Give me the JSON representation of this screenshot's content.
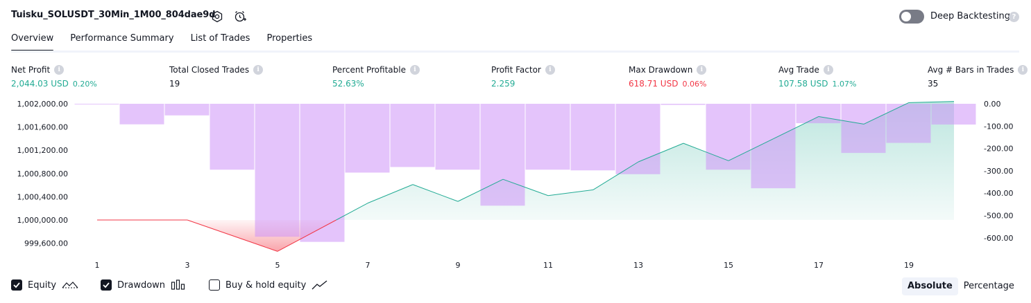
{
  "header": {
    "strategy_title": "Tuisku_SOLUSDT_30Min_1M00_804dae9d",
    "icons": [
      "settings-icon",
      "add-alert-icon"
    ],
    "deep_backtesting_label": "Deep Backtesting",
    "deep_backtesting_on": false
  },
  "tabs": [
    {
      "label": "Overview",
      "active": true
    },
    {
      "label": "Performance Summary",
      "active": false
    },
    {
      "label": "List of Trades",
      "active": false
    },
    {
      "label": "Properties",
      "active": false
    }
  ],
  "metrics": {
    "net_profit": {
      "label": "Net Profit",
      "value": "2,044.03 USD",
      "pct": "0.20%"
    },
    "total_closed_trades": {
      "label": "Total Closed Trades",
      "value": "19"
    },
    "percent_profitable": {
      "label": "Percent Profitable",
      "value": "52.63%"
    },
    "profit_factor": {
      "label": "Profit Factor",
      "value": "2.259"
    },
    "max_drawdown": {
      "label": "Max Drawdown",
      "value": "618.71 USD",
      "pct": "0.06%"
    },
    "avg_trade": {
      "label": "Avg Trade",
      "value": "107.58 USD",
      "pct": "1.07%"
    },
    "avg_bars": {
      "label": "Avg # Bars in Trades",
      "value": "35"
    }
  },
  "colors": {
    "positive": "#22ab94",
    "negative": "#f23645",
    "drawdown_bar": "#ce93f8",
    "equity_line": "#22ab94"
  },
  "chart_data": {
    "type": "line",
    "x_ticks": [
      "1",
      "3",
      "5",
      "7",
      "9",
      "11",
      "13",
      "15",
      "17",
      "19"
    ],
    "y_left_ticks": [
      "1,002,000.00",
      "1,001,600.00",
      "1,001,200.00",
      "1,000,800.00",
      "1,000,400.00",
      "1,000,000.00",
      "999,600.00"
    ],
    "y_right_ticks": [
      "0.00",
      "-100.00",
      "-200.00",
      "-300.00",
      "-400.00",
      "-500.00",
      "-600.00"
    ],
    "ylim_left": [
      999500,
      1002000
    ],
    "ylim_right": [
      -650,
      0
    ],
    "grid": false,
    "series": [
      {
        "type": "line",
        "x": [
          1,
          3,
          5,
          7,
          8,
          9,
          10,
          11,
          12,
          13,
          14,
          15,
          16,
          17,
          18,
          19,
          20
        ],
        "values": [
          1000000,
          1000000,
          999460,
          1000290,
          1000610,
          1000320,
          1000700,
          1000420,
          1000520,
          1001000,
          1001320,
          1001020,
          1001400,
          1001780,
          1001650,
          1002020,
          1002040
        ]
      },
      {
        "type": "bar",
        "x": [
          1,
          2,
          3,
          4,
          5,
          6,
          7,
          8,
          9,
          10,
          11,
          12,
          13,
          14,
          15,
          16,
          17,
          18,
          19,
          20
        ],
        "values": [
          0,
          -92,
          -52,
          -295,
          -595,
          -618,
          -308,
          -283,
          -295,
          -456,
          -295,
          -298,
          -315,
          -5,
          -295,
          -378,
          -87,
          -220,
          -175,
          -93
        ]
      }
    ]
  },
  "legend": {
    "equity": {
      "label": "Equity",
      "checked": true
    },
    "drawdown": {
      "label": "Drawdown",
      "checked": true
    },
    "buy_hold": {
      "label": "Buy & hold equity",
      "checked": false
    }
  },
  "display_mode": {
    "absolute_label": "Absolute",
    "percentage_label": "Percentage",
    "selected": "Absolute"
  }
}
